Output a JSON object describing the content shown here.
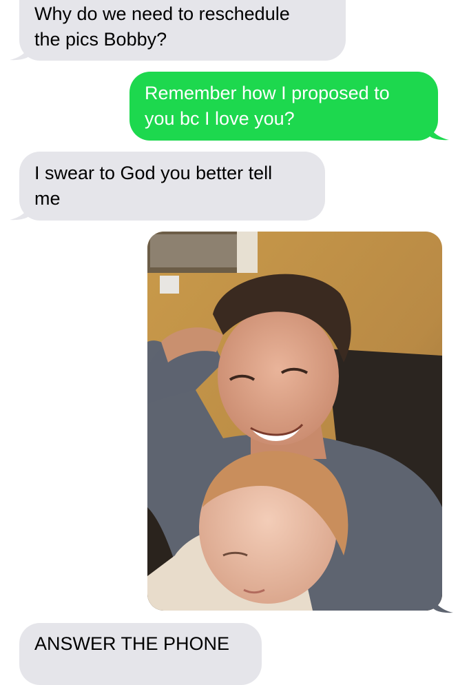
{
  "messages": [
    {
      "direction": "incoming",
      "text": "Why do we need to reschedule\nthe pics Bobby?"
    },
    {
      "direction": "outgoing",
      "text": "Remember how I proposed to\nyou bc I love you?"
    },
    {
      "direction": "incoming",
      "text": "I swear to God you better tell\nme"
    },
    {
      "direction": "outgoing",
      "type": "image",
      "image_alt": "selfie of smiling man with a child"
    },
    {
      "direction": "incoming",
      "text": "ANSWER THE PHONE"
    }
  ],
  "colors": {
    "incoming_bubble": "#e5e5ea",
    "outgoing_bubble": "#1dd84e",
    "outgoing_text": "#ffffff",
    "incoming_text": "#000000",
    "background": "#ffffff"
  }
}
